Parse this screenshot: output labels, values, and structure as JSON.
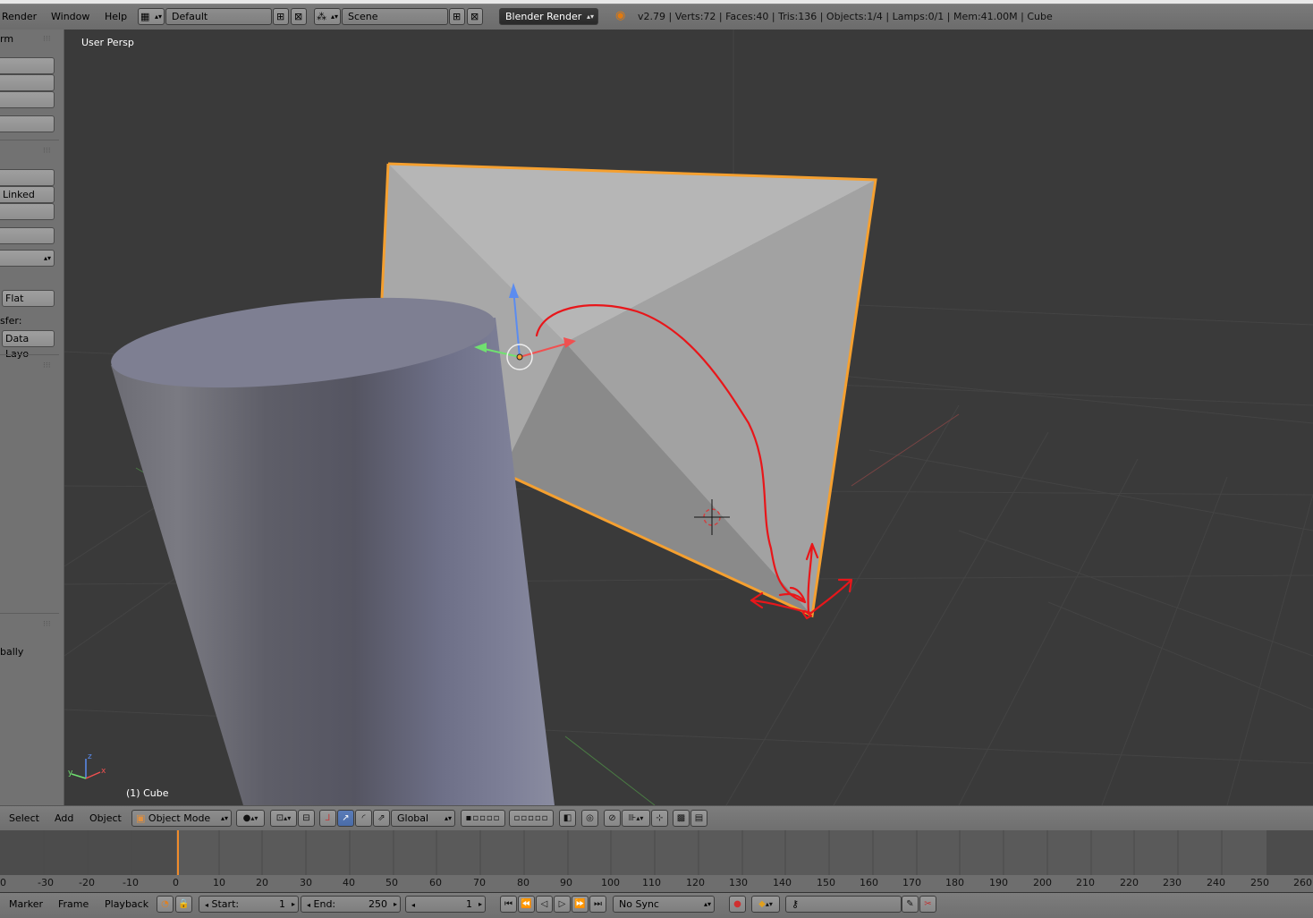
{
  "top_menu": {
    "render": "Render",
    "window": "Window",
    "help": "Help"
  },
  "screen_layout": {
    "value": "Default"
  },
  "scene": {
    "value": "Scene"
  },
  "render_engine": {
    "value": "Blender Render"
  },
  "stats": "v2.79 | Verts:72 | Faces:40 | Tris:136 | Objects:1/4 | Lamps:0/1 | Mem:41.00M | Cube",
  "toolshelf": {
    "panel1_title": "rm",
    "linked_label": "Linked",
    "flat_label": "Flat",
    "transfer_label": "sfer:",
    "data_layout_label": "Data Layo",
    "globally_label": "bally"
  },
  "viewport": {
    "view_name": "User Persp",
    "object_name": "(1) Cube",
    "axis_labels": {
      "z": "z",
      "x": "x",
      "y": "y"
    }
  },
  "view3d_header": {
    "select": "Select",
    "add": "Add",
    "object": "Object",
    "mode": "Object Mode",
    "orientation": "Global"
  },
  "timeline": {
    "ticks": [
      "0",
      "-30",
      "-20",
      "-10",
      "0",
      "10",
      "20",
      "30",
      "40",
      "50",
      "60",
      "70",
      "80",
      "90",
      "100",
      "110",
      "120",
      "130",
      "140",
      "150",
      "160",
      "170",
      "180",
      "190",
      "200",
      "210",
      "220",
      "230",
      "240",
      "250",
      "260"
    ],
    "current_frame_marker": 0
  },
  "timeline_header": {
    "marker": "Marker",
    "frame": "Frame",
    "playback": "Playback",
    "start_label": "Start:",
    "start_value": "1",
    "end_label": "End:",
    "end_value": "250",
    "current_frame": "1",
    "sync": "No Sync"
  },
  "colors": {
    "selection_outline": "#f5a030",
    "annotation": "#e8161a",
    "gizmo_z": "#5b8cf0",
    "gizmo_x": "#f05050",
    "gizmo_y": "#70e070"
  }
}
